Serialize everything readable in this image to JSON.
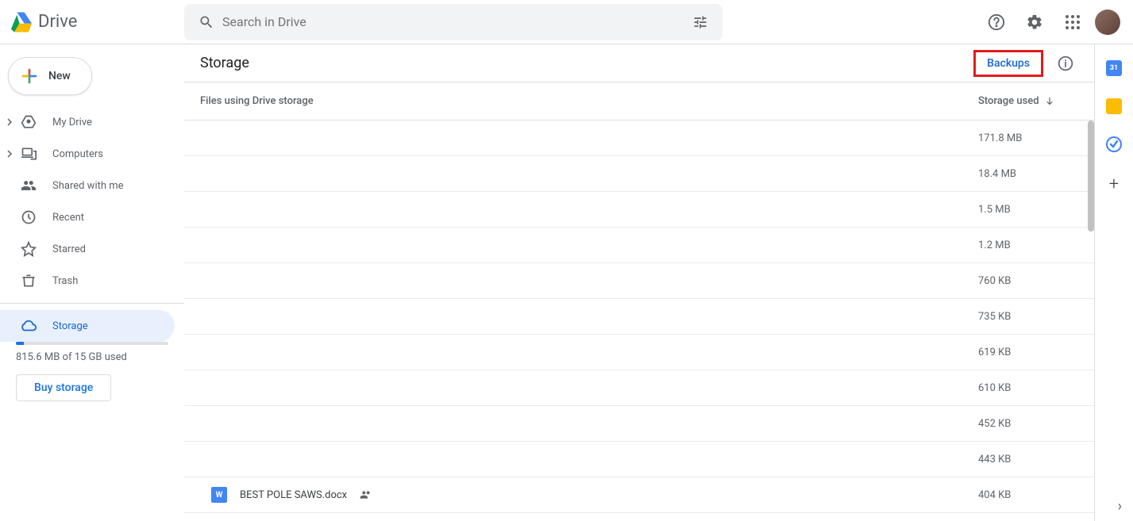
{
  "header": {
    "app_name": "Drive",
    "search_placeholder": "Search in Drive"
  },
  "sidebar": {
    "new_label": "New",
    "items": [
      {
        "label": "My Drive"
      },
      {
        "label": "Computers"
      },
      {
        "label": "Shared with me"
      },
      {
        "label": "Recent"
      },
      {
        "label": "Starred"
      },
      {
        "label": "Trash"
      },
      {
        "label": "Storage"
      }
    ],
    "storage_used_text": "815.6 MB of 15 GB used",
    "buy_label": "Buy storage"
  },
  "main": {
    "title": "Storage",
    "backups_label": "Backups",
    "col_files": "Files using Drive storage",
    "col_storage": "Storage used",
    "rows": [
      {
        "name": "",
        "size": "171.8 MB"
      },
      {
        "name": "",
        "size": "18.4 MB"
      },
      {
        "name": "",
        "size": "1.5 MB"
      },
      {
        "name": "",
        "size": "1.2 MB"
      },
      {
        "name": "",
        "size": "760 KB"
      },
      {
        "name": "",
        "size": "735 KB"
      },
      {
        "name": "",
        "size": "619 KB"
      },
      {
        "name": "",
        "size": "610 KB"
      },
      {
        "name": "",
        "size": "452 KB"
      },
      {
        "name": "",
        "size": "443 KB"
      },
      {
        "name": "BEST POLE SAWS.docx",
        "size": "404 KB",
        "icon": "W",
        "shared": true
      }
    ]
  },
  "sidepanel": {
    "cal_day": "31"
  }
}
